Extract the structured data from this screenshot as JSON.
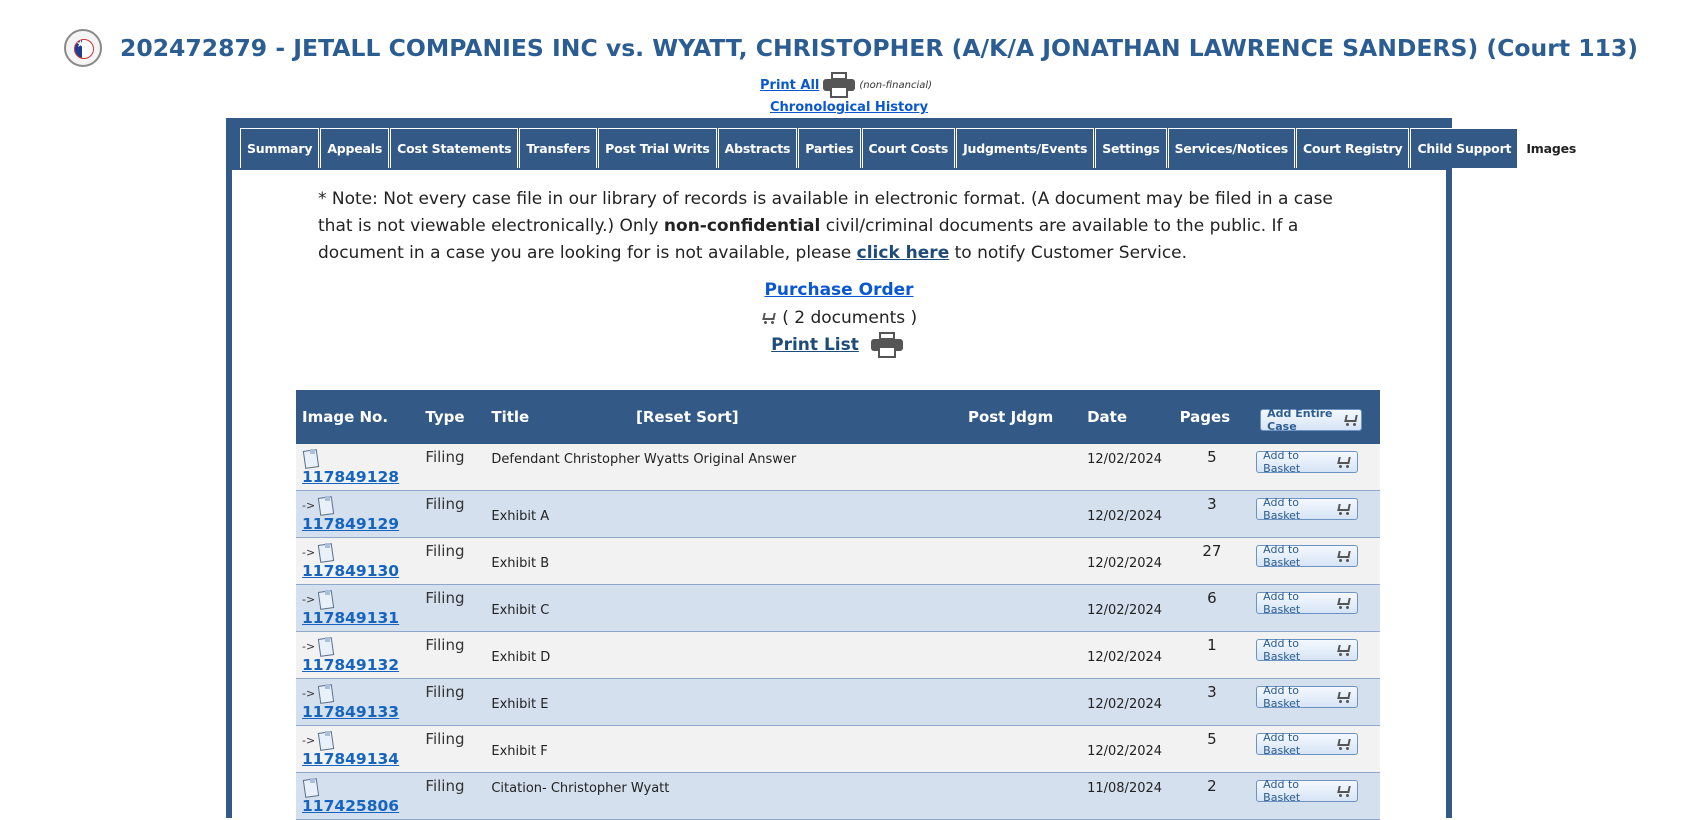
{
  "header": {
    "title": "202472879 - JETALL COMPANIES INC vs. WYATT, CHRISTOPHER (A/K/A JONATHAN LAWRENCE SANDERS) (Court 113)",
    "print_all": "Print All",
    "non_financial": "(non-financial)",
    "chronological_history": "Chronological History"
  },
  "tabs": [
    {
      "label": "Summary"
    },
    {
      "label": "Appeals"
    },
    {
      "label": "Cost Statements"
    },
    {
      "label": "Transfers"
    },
    {
      "label": "Post Trial Writs"
    },
    {
      "label": "Abstracts"
    },
    {
      "label": "Parties"
    },
    {
      "label": "Court Costs"
    },
    {
      "label": "Judgments/Events"
    },
    {
      "label": "Settings"
    },
    {
      "label": "Services/Notices"
    },
    {
      "label": "Court Registry"
    },
    {
      "label": "Child Support"
    },
    {
      "label": "Images",
      "active": true
    }
  ],
  "note": {
    "part1": "* Note: Not every case file in our library of records is available in electronic format. (A document may be filed in a case that is not viewable electronically.) Only ",
    "bold": "non-confidential",
    "part2": " civil/criminal documents are available to the public. If a document in a case you are looking for is not available, please ",
    "link": "click here",
    "part3": " to notify Customer Service."
  },
  "purchase_order": "Purchase Order",
  "documents_count": "( 2 documents )",
  "print_list": "Print List",
  "table": {
    "headers": {
      "image_no": "Image No.",
      "type": "Type",
      "title": "Title",
      "reset_sort": "[Reset Sort]",
      "post_jdgm": "Post Jdgm",
      "date": "Date",
      "pages": "Pages",
      "add_entire_case": "Add Entire Case"
    },
    "add_to_basket": "Add to Basket",
    "rows": [
      {
        "image_no": "117849128",
        "type": "Filing",
        "title": "Defendant Christopher Wyatts Original Answer",
        "date": "12/02/2024",
        "pages": "5",
        "child": false
      },
      {
        "image_no": "117849129",
        "type": "Filing",
        "title": "Exhibit A",
        "date": "12/02/2024",
        "pages": "3",
        "child": true
      },
      {
        "image_no": "117849130",
        "type": "Filing",
        "title": "Exhibit B",
        "date": "12/02/2024",
        "pages": "27",
        "child": true
      },
      {
        "image_no": "117849131",
        "type": "Filing",
        "title": "Exhibit C",
        "date": "12/02/2024",
        "pages": "6",
        "child": true
      },
      {
        "image_no": "117849132",
        "type": "Filing",
        "title": "Exhibit D",
        "date": "12/02/2024",
        "pages": "1",
        "child": true
      },
      {
        "image_no": "117849133",
        "type": "Filing",
        "title": "Exhibit E",
        "date": "12/02/2024",
        "pages": "3",
        "child": true
      },
      {
        "image_no": "117849134",
        "type": "Filing",
        "title": "Exhibit F",
        "date": "12/02/2024",
        "pages": "5",
        "child": true
      },
      {
        "image_no": "117425806",
        "type": "Filing",
        "title": "Citation- Christopher Wyatt",
        "date": "11/08/2024",
        "pages": "2",
        "child": false
      }
    ]
  }
}
